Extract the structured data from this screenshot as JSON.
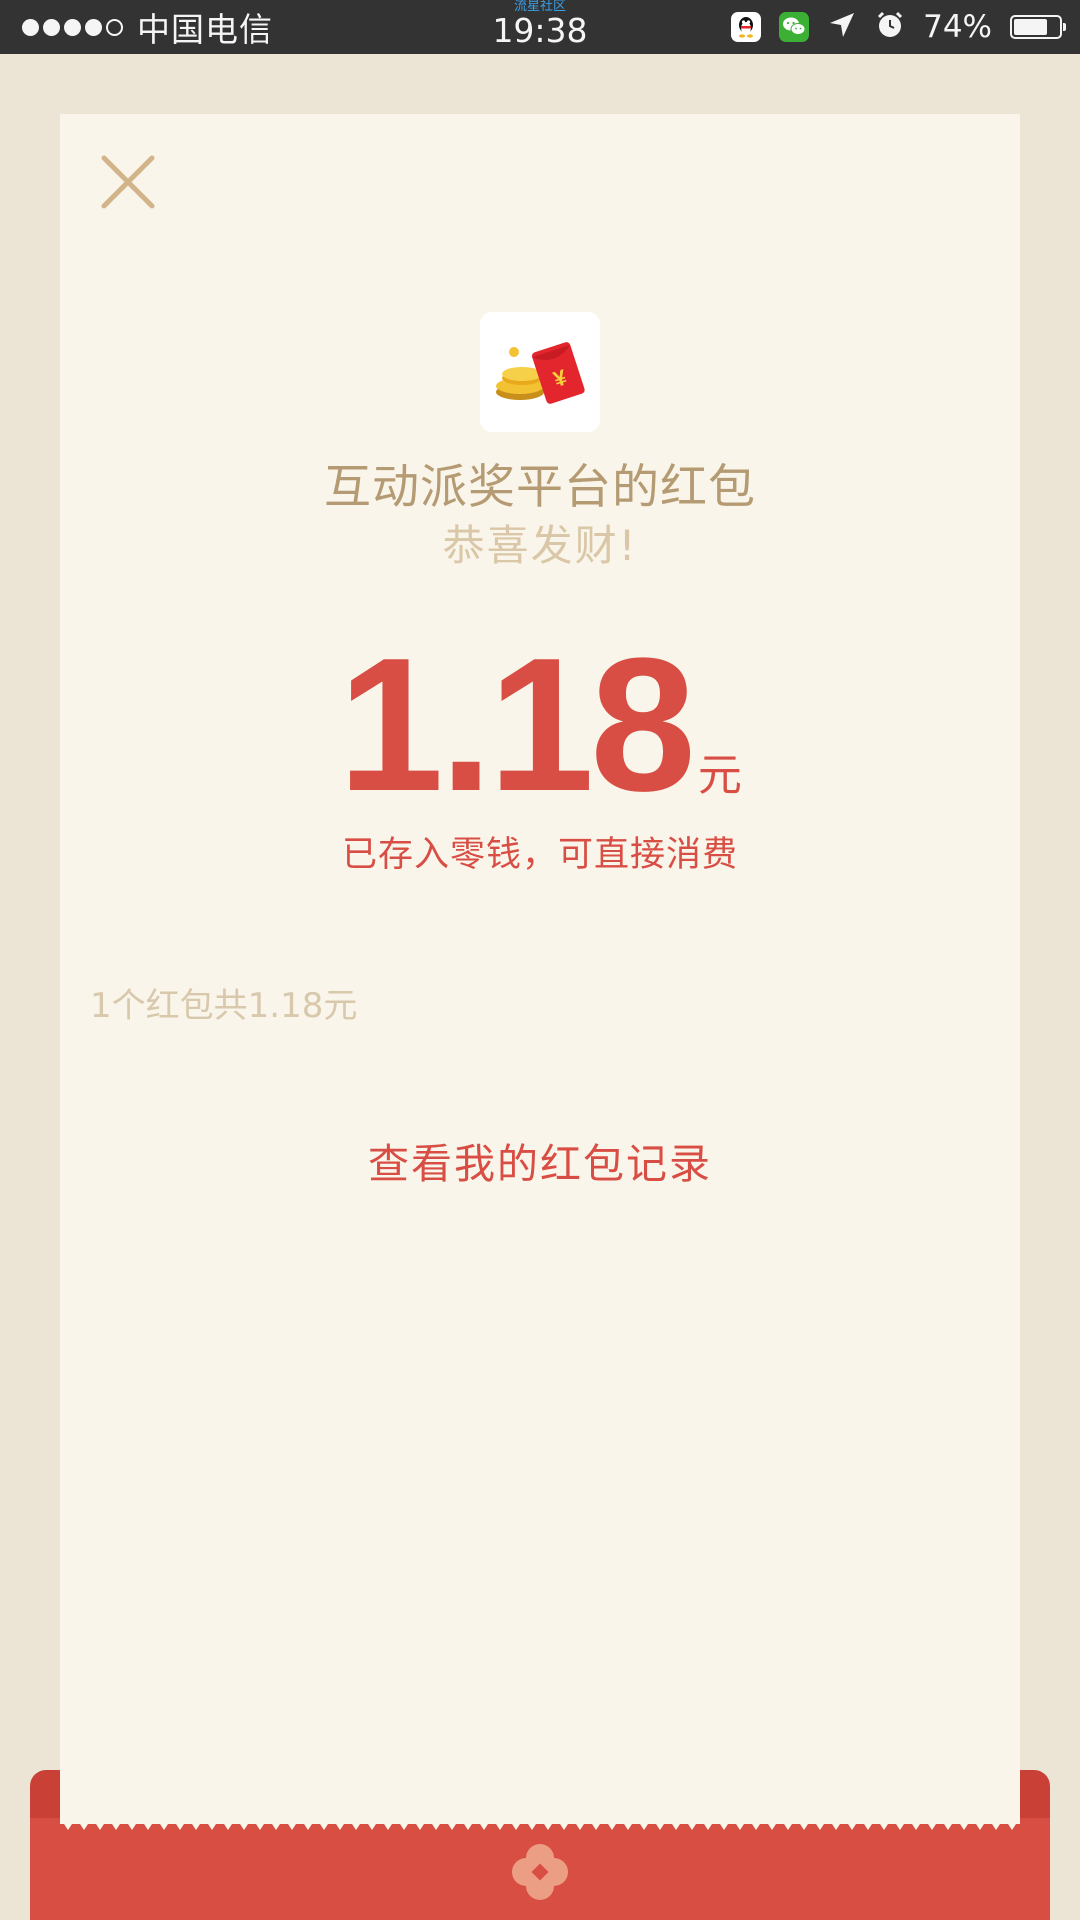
{
  "status_bar": {
    "carrier": "中国电信",
    "time": "19:38",
    "watermark": "流星社区",
    "battery_percent": "74%",
    "battery_level": 0.74,
    "icons": [
      "signal-dots",
      "qq-icon",
      "wechat-icon",
      "location-arrow-icon",
      "alarm-clock-icon",
      "battery-icon"
    ]
  },
  "red_packet": {
    "sender": "互动派奖平台的红包",
    "greeting": "恭喜发财!",
    "amount": "1.18",
    "unit": "元",
    "stored_note": "已存入零钱，可直接消费",
    "summary": "1个红包共1.18元",
    "history_link": "查看我的红包记录"
  },
  "icons": {
    "close": "close-icon",
    "logo": "red-packet-coins-logo",
    "seal": "flower-seal-icon"
  },
  "colors": {
    "background": "#ece4d4",
    "card": "#faf5ea",
    "accent_red": "#d84e44",
    "gold_text": "#b59b73",
    "muted_text": "#d8c8ac",
    "status_bar": "#333333"
  }
}
